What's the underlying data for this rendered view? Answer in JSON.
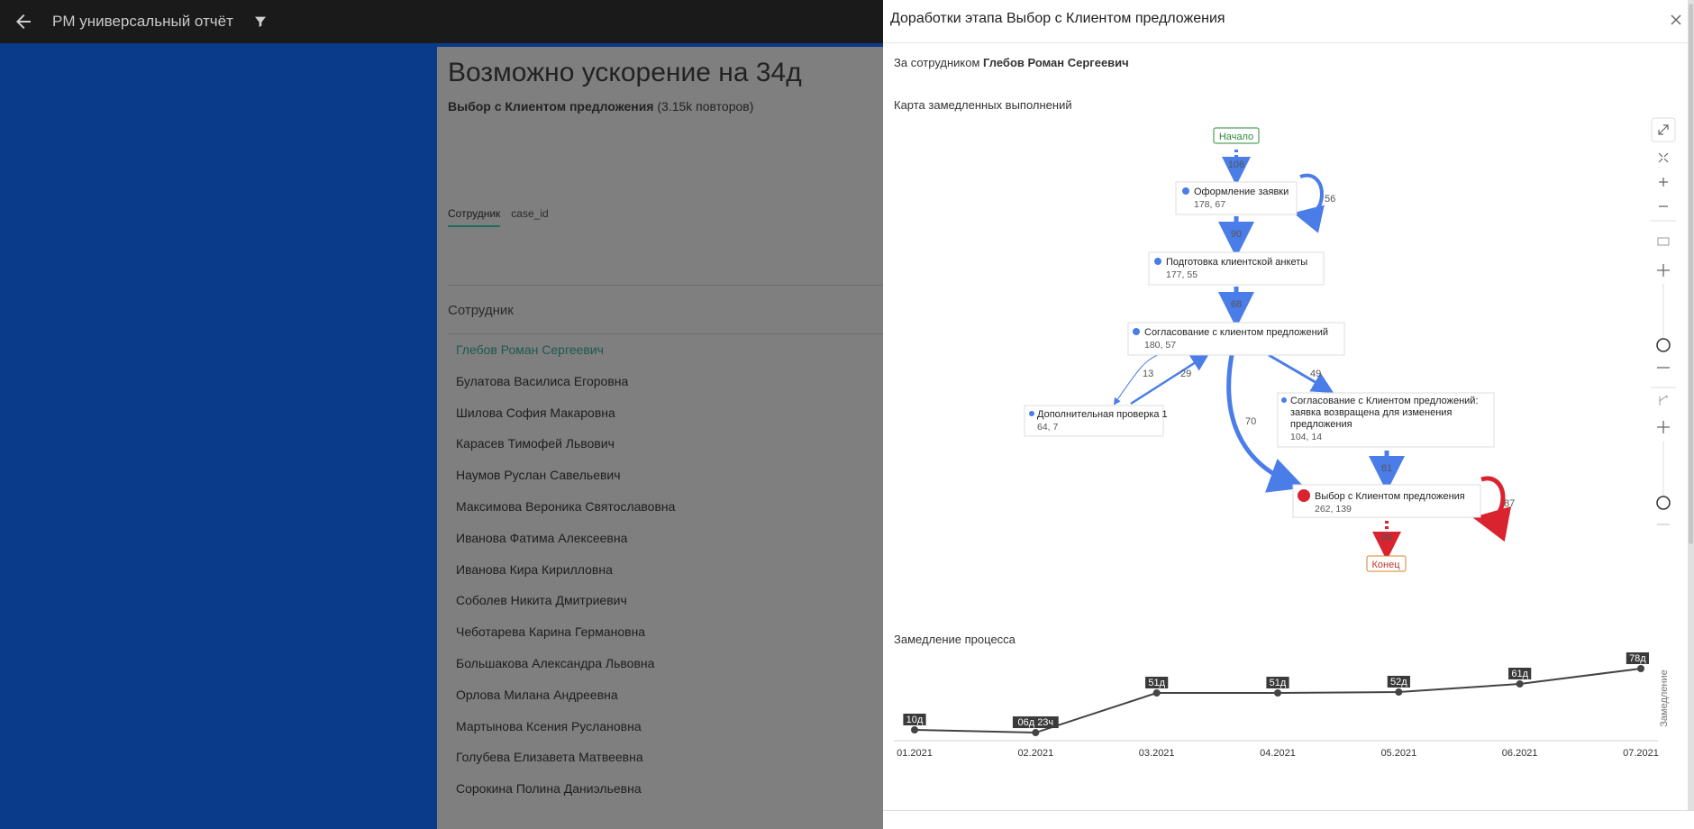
{
  "appbar": {
    "title": "PM универсальный отчёт"
  },
  "report": {
    "headline": "Возможно ускорение на 34д",
    "activity": "Выбор с Клиентом предложения",
    "repeats": "(3.15k повторов)",
    "tabs": [
      "Сотрудник",
      "case_id"
    ],
    "column_header": "Сотрудник",
    "employees": [
      "Глебов Роман Сергеевич",
      "Булатова Василиса Егоровна",
      "Шилова София Макаровна",
      "Карасев Тимофей Львович",
      "Наумов Руслан Савельевич",
      "Максимова Вероника Святославовна",
      "Иванова Фатима Алексеевна",
      "Иванова Кира Кирилловна",
      "Соболев Никита Дмитриевич",
      "Чеботарева Карина Германовна",
      "Большакова Александра Львовна",
      "Орлова Милана Андреевна",
      "Мартынова Ксения Руслановна",
      "Голубева Елизавета Матвеевна",
      "Сорокина Полина Даниэльевна"
    ]
  },
  "panel": {
    "title": "Доработки этапа Выбор с Клиентом предложения",
    "employee_prefix": "За сотрудником",
    "employee_name": "Глебов Роман Сергеевич",
    "map_label": "Карта замедленных выполнений",
    "slowdown_label": "Замедление процесса"
  },
  "process_map": {
    "start": "Начало",
    "end": "Конец",
    "nodes": [
      {
        "name": "Оформление заявки",
        "stats": "178, 67"
      },
      {
        "name": "Подготовка клиентской анкеты",
        "stats": "177, 55"
      },
      {
        "name": "Согласование с клиентом предложений",
        "stats": "180, 57"
      },
      {
        "name": "Дополнительная проверка 1",
        "stats": "64, 7"
      },
      {
        "name_lines": [
          "Согласование с Клиентом предложений:",
          "заявка возвращена для изменения",
          "предложения"
        ],
        "stats": "104, 14"
      },
      {
        "name": "Выбор с Клиентом предложения",
        "stats": "262, 139"
      }
    ],
    "edges": [
      "106",
      "56",
      "90",
      "68",
      "13",
      "29",
      "49",
      "70",
      "81",
      "87",
      "84"
    ],
    "colors": {
      "normal": "#4a7de8",
      "slow": "#d9232e",
      "start": "#2e8b3a",
      "end": "#d9822b"
    }
  },
  "chart_data": {
    "type": "line",
    "categories": [
      "01.2021",
      "02.2021",
      "03.2021",
      "04.2021",
      "05.2021",
      "06.2021",
      "07.2021"
    ],
    "values_days": [
      10,
      6.96,
      51,
      51,
      52,
      61,
      78
    ],
    "labels": [
      "10д",
      "06д 23ч",
      "51д",
      "51д",
      "52д",
      "61д",
      "78д"
    ],
    "ylabel": "Замедление",
    "color": "#444444"
  }
}
